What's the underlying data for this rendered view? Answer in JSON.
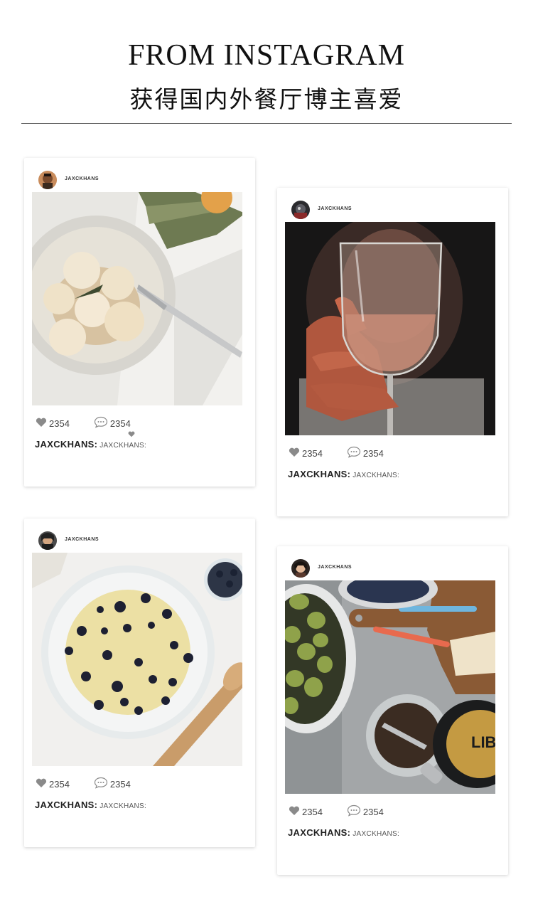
{
  "header": {
    "title": "FROM INSTAGRAM",
    "subtitle": "获得国内外餐厅博主喜爱"
  },
  "posts": [
    {
      "username": "JAXCKHANS",
      "likes": "2354",
      "comments": "2354",
      "caption_user": "JAXCKHANS:",
      "caption_text": "JAXCKHANS:",
      "photo_subject": "gnocchi-with-sage-plate"
    },
    {
      "username": "JAXCKHANS",
      "likes": "2354",
      "comments": "2354",
      "caption_user": "JAXCKHANS:",
      "caption_text": "JAXCKHANS:",
      "photo_subject": "hand-holding-wine-glass"
    },
    {
      "username": "JAXCKHANS",
      "likes": "2354",
      "comments": "2354",
      "caption_user": "JAXCKHANS:",
      "caption_text": "JAXCKHANS:",
      "photo_subject": "blueberry-batter-bowl"
    },
    {
      "username": "JAXCKHANS",
      "likes": "2354",
      "comments": "2354",
      "caption_user": "JAXCKHANS:",
      "caption_text": "JAXCKHANS:",
      "photo_subject": "olives-and-jar-board"
    }
  ],
  "icons": {
    "like": "heart-icon",
    "comment": "comment-bubble-icon"
  },
  "colors": {
    "icon_gray": "#8a8a8a",
    "divider": "#555555"
  }
}
